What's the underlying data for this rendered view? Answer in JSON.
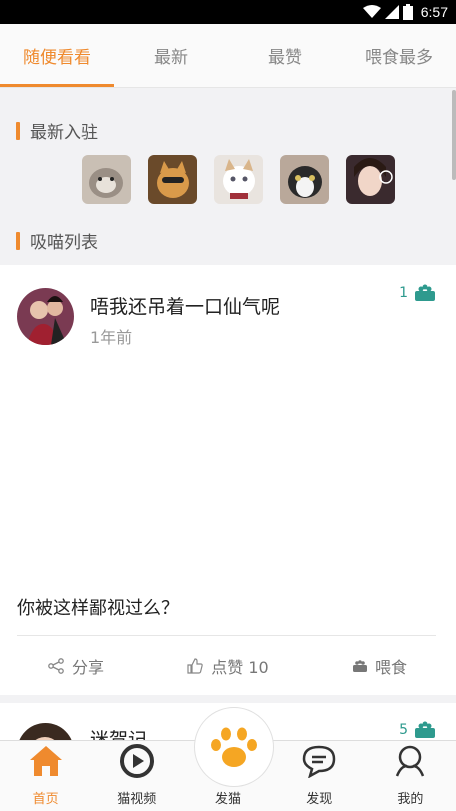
{
  "status_bar": {
    "time": "6:57"
  },
  "tabs": [
    {
      "label": "随便看看",
      "active": true
    },
    {
      "label": "最新",
      "active": false
    },
    {
      "label": "最赞",
      "active": false
    },
    {
      "label": "喂食最多",
      "active": false
    }
  ],
  "new_arrivals": {
    "title": "最新入驻"
  },
  "cat_list": {
    "title": "吸喵列表"
  },
  "post": {
    "author": "唔我还吊着一口仙气呢",
    "time": "1年前",
    "feed_count": "1",
    "text": "你被这样鄙视过么？",
    "share_label": "分享",
    "like_label": "点赞 10",
    "feed_label": "喂食"
  },
  "post2": {
    "author": "迷贺记",
    "feed_count": "5"
  },
  "bottom_nav": {
    "home": "首页",
    "video": "猫视频",
    "post": "发猫",
    "discover": "发现",
    "me": "我的"
  },
  "colors": {
    "accent": "#ef8a2e",
    "feed": "#2e9a8e"
  }
}
